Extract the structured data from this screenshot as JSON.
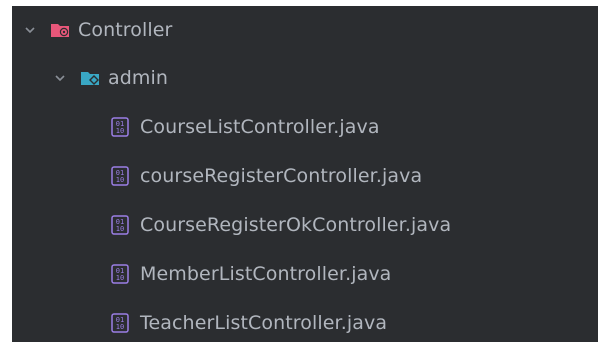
{
  "project_tree": {
    "folder": {
      "label": "Controller",
      "icon": "controller-folder-icon",
      "expanded": true,
      "subfolder": {
        "label": "admin",
        "icon": "package-folder-icon",
        "expanded": true,
        "files": [
          {
            "label": "CourseListController.java",
            "icon": "java-class-file-icon"
          },
          {
            "label": "courseRegisterController.java",
            "icon": "java-class-file-icon"
          },
          {
            "label": "CourseRegisterOkController.java",
            "icon": "java-class-file-icon"
          },
          {
            "label": "MemberListController.java",
            "icon": "java-class-file-icon"
          },
          {
            "label": "TeacherListController.java",
            "icon": "java-class-file-icon"
          }
        ]
      }
    }
  },
  "colors": {
    "background": "#2b2d30",
    "text": "#b1b6be",
    "chevron": "#8a8f97",
    "controller_folder": "#e8577a",
    "package_folder": "#39a7c4",
    "file_icon": "#9b7ee6"
  }
}
